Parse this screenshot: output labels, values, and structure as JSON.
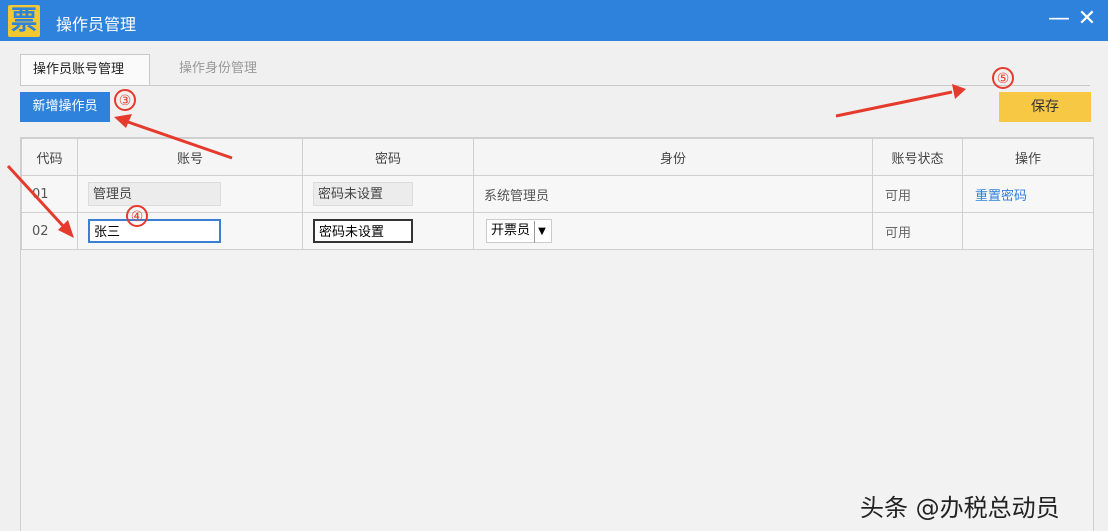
{
  "window": {
    "app_icon": "票",
    "title": "操作员管理",
    "minimize": "—",
    "close": "✕"
  },
  "tabs": [
    {
      "label": "操作员账号管理",
      "active": true
    },
    {
      "label": "操作身份管理",
      "active": false
    }
  ],
  "toolbar": {
    "add_label": "新增操作员",
    "save_label": "保存"
  },
  "table": {
    "headers": [
      "代码",
      "账号",
      "密码",
      "身份",
      "账号状态",
      "操作"
    ],
    "rows": [
      {
        "code": "01",
        "account": "管理员",
        "password": "密码未设置",
        "role": "系统管理员",
        "status": "可用",
        "action": "重置密码"
      },
      {
        "code": "02",
        "account": "张三",
        "password": "密码未设置",
        "role": "开票员",
        "status": "可用",
        "action": ""
      }
    ]
  },
  "annotations": {
    "a3": "③",
    "a4": "④",
    "a5": "⑤"
  },
  "watermark": "头条 @办税总动员",
  "colors": {
    "titlebar": "#2f82dc",
    "add_button": "#2f82dc",
    "save_button": "#f7c843",
    "annotation": "#e53a2c"
  }
}
